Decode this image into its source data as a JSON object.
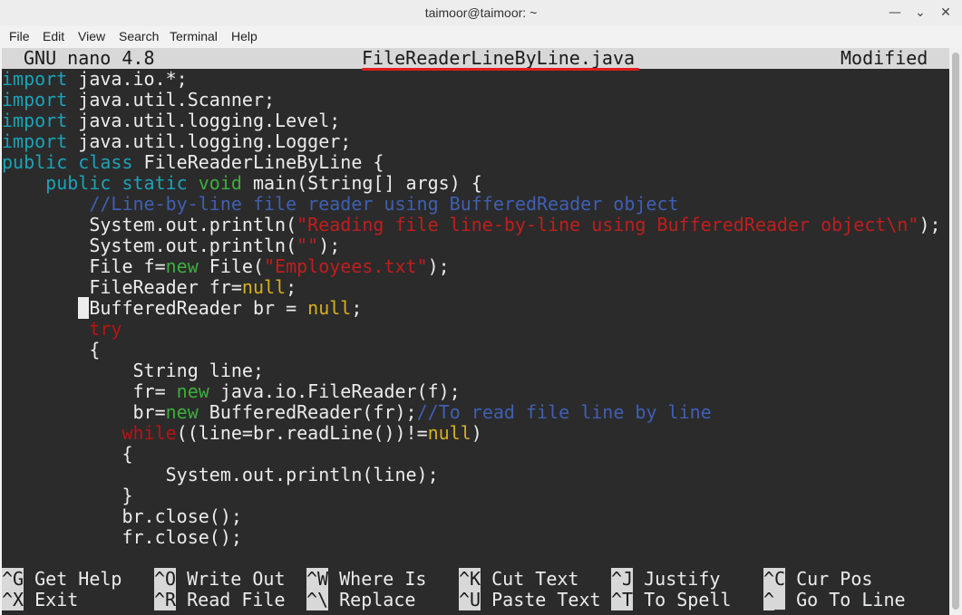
{
  "window": {
    "title": "taimoor@taimoor: ~"
  },
  "menu": [
    "File",
    "Edit",
    "View",
    "Search",
    "Terminal",
    "Help"
  ],
  "nano": {
    "version": "GNU nano 4.8",
    "filename": "FileReaderLineByLine.java",
    "status": "Modified"
  },
  "code_lines": [
    [
      {
        "t": "import",
        "c": "kw"
      },
      {
        "t": " java.io.*;"
      }
    ],
    [
      {
        "t": "import",
        "c": "kw"
      },
      {
        "t": " java.util.Scanner;"
      }
    ],
    [
      {
        "t": "import",
        "c": "kw"
      },
      {
        "t": " java.util.logging.Level;"
      }
    ],
    [
      {
        "t": "import",
        "c": "kw"
      },
      {
        "t": " java.util.logging.Logger;"
      }
    ],
    [
      {
        "t": "public class",
        "c": "kw"
      },
      {
        "t": " FileReaderLineByLine {"
      }
    ],
    [
      {
        "t": "    "
      },
      {
        "t": "public static",
        "c": "kw"
      },
      {
        "t": " "
      },
      {
        "t": "void",
        "c": "gr"
      },
      {
        "t": " main(String[] args) {"
      }
    ],
    [
      {
        "t": "        "
      },
      {
        "t": "//Line-by-line file reader using BufferedReader object",
        "c": "cm"
      }
    ],
    [
      {
        "t": "        System.out.println("
      },
      {
        "t": "\"Reading file line-by-line using BufferedReader object\\n\"",
        "c": "str"
      },
      {
        "t": ");"
      }
    ],
    [
      {
        "t": "        System.out.println("
      },
      {
        "t": "\"\"",
        "c": "str"
      },
      {
        "t": ");"
      }
    ],
    [
      {
        "t": "        File f="
      },
      {
        "t": "new",
        "c": "gr"
      },
      {
        "t": " File("
      },
      {
        "t": "\"Employees.txt\"",
        "c": "str"
      },
      {
        "t": ");"
      }
    ],
    [
      {
        "t": "        FileReader fr="
      },
      {
        "t": "null",
        "c": "ye"
      },
      {
        "t": ";"
      }
    ],
    [
      {
        "t": "       "
      },
      {
        "t": " ",
        "c": "cursor"
      },
      {
        "t": "BufferedReader br = "
      },
      {
        "t": "null",
        "c": "ye"
      },
      {
        "t": ";"
      }
    ],
    [
      {
        "t": "        "
      },
      {
        "t": "try",
        "c": "rd"
      }
    ],
    [
      {
        "t": "        {"
      }
    ],
    [
      {
        "t": "            String line;"
      }
    ],
    [
      {
        "t": "            fr= "
      },
      {
        "t": "new",
        "c": "gr"
      },
      {
        "t": " java.io.FileReader(f);"
      }
    ],
    [
      {
        "t": "            br="
      },
      {
        "t": "new",
        "c": "gr"
      },
      {
        "t": " BufferedReader(fr);"
      },
      {
        "t": "//To read file line by line",
        "c": "cm"
      }
    ],
    [
      {
        "t": "           "
      },
      {
        "t": "while",
        "c": "rd"
      },
      {
        "t": "((line=br.readLine())!="
      },
      {
        "t": "null",
        "c": "ye"
      },
      {
        "t": ")"
      }
    ],
    [
      {
        "t": "           {"
      }
    ],
    [
      {
        "t": "               System.out.println(line);"
      }
    ],
    [
      {
        "t": "           }"
      }
    ],
    [
      {
        "t": "           br.close();"
      }
    ],
    [
      {
        "t": "           fr.close();"
      }
    ]
  ],
  "shortcuts": [
    [
      {
        "key": "^G",
        "label": "Get Help"
      },
      {
        "key": "^O",
        "label": "Write Out"
      },
      {
        "key": "^W",
        "label": "Where Is"
      },
      {
        "key": "^K",
        "label": "Cut Text"
      },
      {
        "key": "^J",
        "label": "Justify"
      },
      {
        "key": "^C",
        "label": "Cur Pos"
      }
    ],
    [
      {
        "key": "^X",
        "label": "Exit"
      },
      {
        "key": "^R",
        "label": "Read File"
      },
      {
        "key": "^\\",
        "label": "Replace"
      },
      {
        "key": "^U",
        "label": "Paste Text"
      },
      {
        "key": "^T",
        "label": "To Spell"
      },
      {
        "key": "^_",
        "label": "Go To Line"
      }
    ]
  ]
}
